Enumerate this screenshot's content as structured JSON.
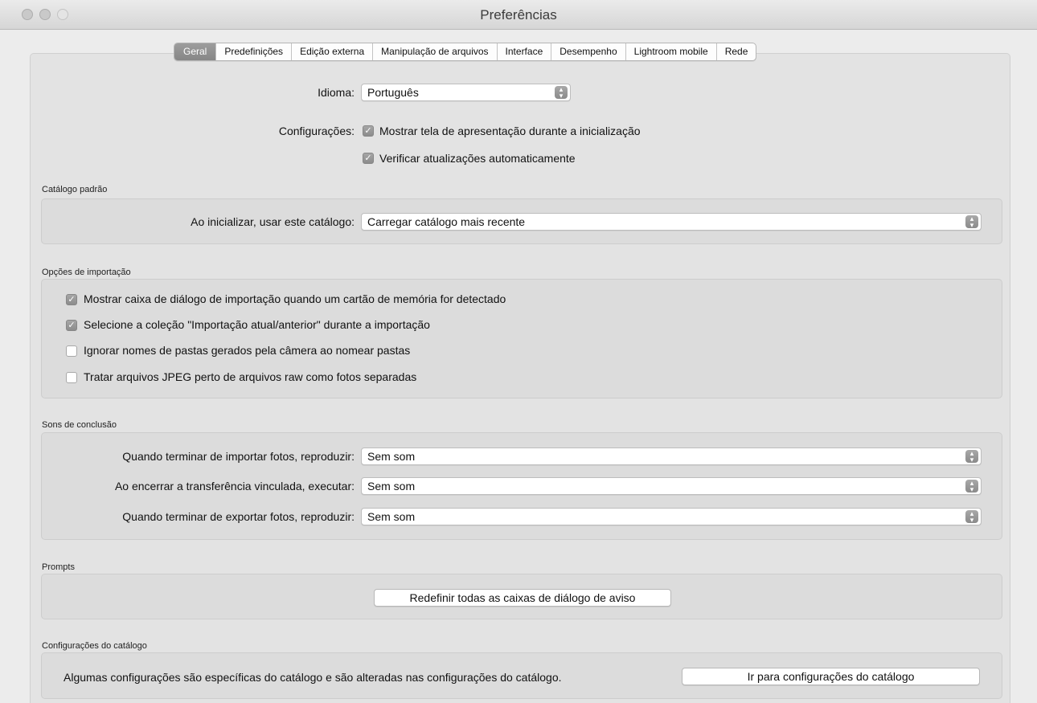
{
  "window": {
    "title": "Preferências"
  },
  "tabs": [
    {
      "label": "Geral",
      "active": true
    },
    {
      "label": "Predefinições"
    },
    {
      "label": "Edição externa"
    },
    {
      "label": "Manipulação de arquivos"
    },
    {
      "label": "Interface"
    },
    {
      "label": "Desempenho"
    },
    {
      "label": "Lightroom mobile"
    },
    {
      "label": "Rede"
    }
  ],
  "language": {
    "label": "Idioma:",
    "value": "Português"
  },
  "settings": {
    "label": "Configurações:",
    "options": [
      {
        "label": "Mostrar tela de apresentação durante a inicialização",
        "checked": true
      },
      {
        "label": "Verificar atualizações automaticamente",
        "checked": true
      }
    ]
  },
  "default_catalog": {
    "title": "Catálogo padrão",
    "label": "Ao inicializar, usar este catálogo:",
    "value": "Carregar catálogo mais recente"
  },
  "import_options": {
    "title": "Opções de importação",
    "options": [
      {
        "label": "Mostrar caixa de diálogo de importação quando um cartão de memória for detectado",
        "checked": true
      },
      {
        "label": "Selecione a coleção \"Importação atual/anterior\" durante a importação",
        "checked": true
      },
      {
        "label": "Ignorar nomes de pastas gerados pela câmera ao nomear pastas",
        "checked": false
      },
      {
        "label": "Tratar arquivos JPEG perto de arquivos raw como fotos separadas",
        "checked": false
      }
    ]
  },
  "completion_sounds": {
    "title": "Sons de conclusão",
    "rows": [
      {
        "label": "Quando terminar de importar fotos, reproduzir:",
        "value": "Sem som"
      },
      {
        "label": "Ao encerrar a transferência vinculada, executar:",
        "value": "Sem som"
      },
      {
        "label": "Quando terminar de exportar fotos, reproduzir:",
        "value": "Sem som"
      }
    ]
  },
  "prompts": {
    "title": "Prompts",
    "button": "Redefinir todas as caixas de diálogo de aviso"
  },
  "catalog_settings": {
    "title": "Configurações do catálogo",
    "note": "Algumas configurações são específicas do catálogo e são alteradas nas configurações do catálogo.",
    "button": "Ir para configurações do catálogo"
  },
  "icons": {
    "checkmark": "✓",
    "stepper": "⌃⌄"
  }
}
